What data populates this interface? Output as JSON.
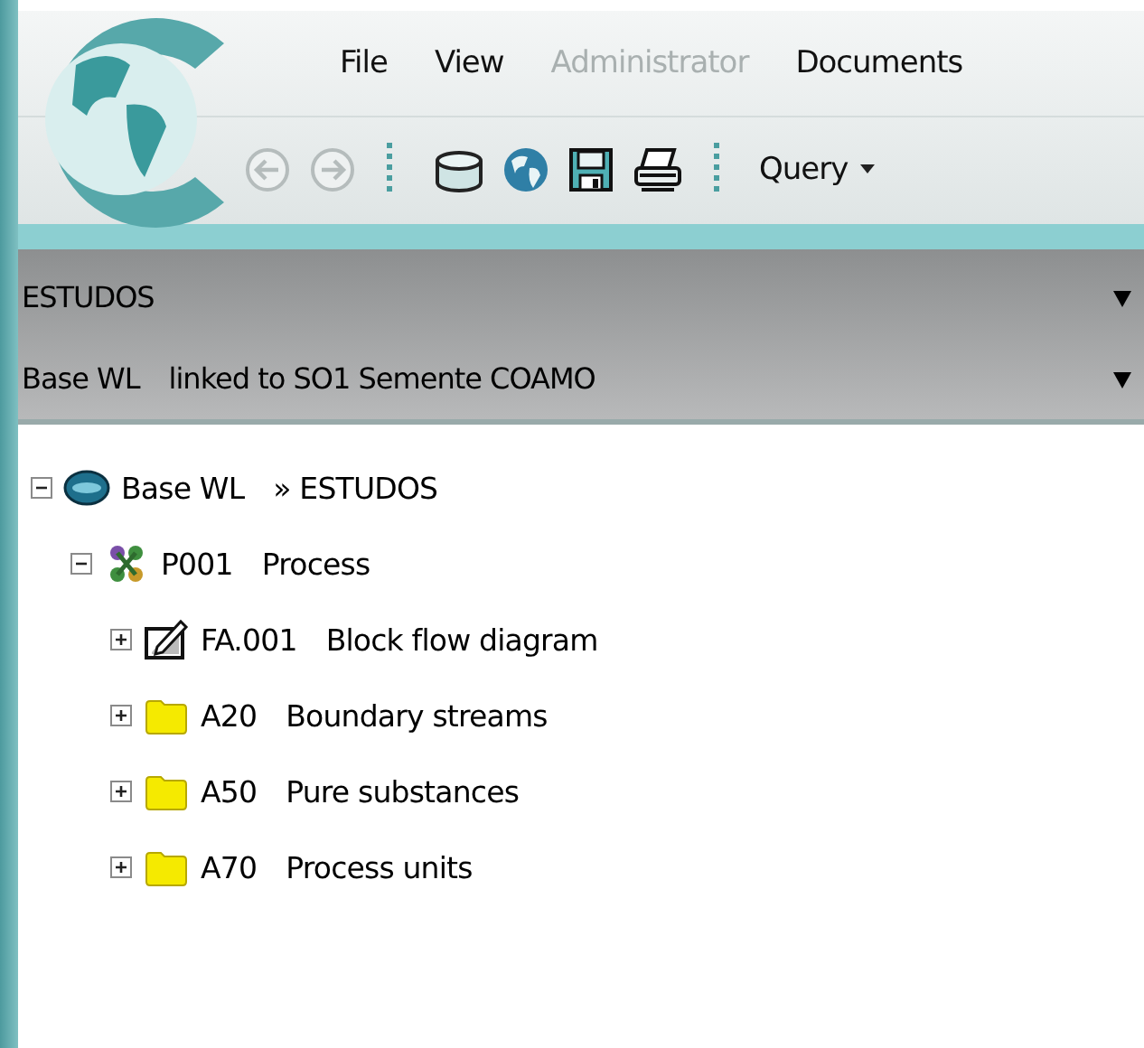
{
  "menu": [
    {
      "label": "File",
      "disabled": false
    },
    {
      "label": "View",
      "disabled": false
    },
    {
      "label": "Administrator",
      "disabled": true
    },
    {
      "label": "Documents",
      "disabled": false
    }
  ],
  "toolbar": [
    {
      "kind": "back",
      "disabled": true
    },
    {
      "kind": "forward",
      "disabled": true
    },
    {
      "kind": "separator"
    },
    {
      "kind": "database",
      "disabled": false
    },
    {
      "kind": "globe",
      "disabled": false
    },
    {
      "kind": "save",
      "disabled": false
    },
    {
      "kind": "print",
      "disabled": false
    },
    {
      "kind": "separator"
    },
    {
      "kind": "dropdown",
      "label": "Query",
      "disabled": false
    }
  ],
  "selectors": [
    {
      "parts": [
        "ESTUDOS"
      ]
    },
    {
      "parts": [
        "Base WL",
        "linked to SO1 Semente COAMO"
      ]
    }
  ],
  "tree": [
    {
      "kind": "database",
      "code": "Base WL",
      "name": "» ESTUDOS",
      "expanded": true,
      "children": [
        {
          "kind": "process",
          "code": "P001",
          "name": "Process",
          "expanded": true,
          "children": [
            {
              "kind": "diagram",
              "code": "FA.001",
              "name": "Block flow diagram",
              "expanded": false
            },
            {
              "kind": "folder",
              "code": "A20",
              "name": "Boundary streams",
              "expanded": false
            },
            {
              "kind": "folder",
              "code": "A50",
              "name": "Pure substances",
              "expanded": false
            },
            {
              "kind": "folder",
              "code": "A70",
              "name": "Process units",
              "expanded": false
            }
          ]
        }
      ]
    }
  ]
}
